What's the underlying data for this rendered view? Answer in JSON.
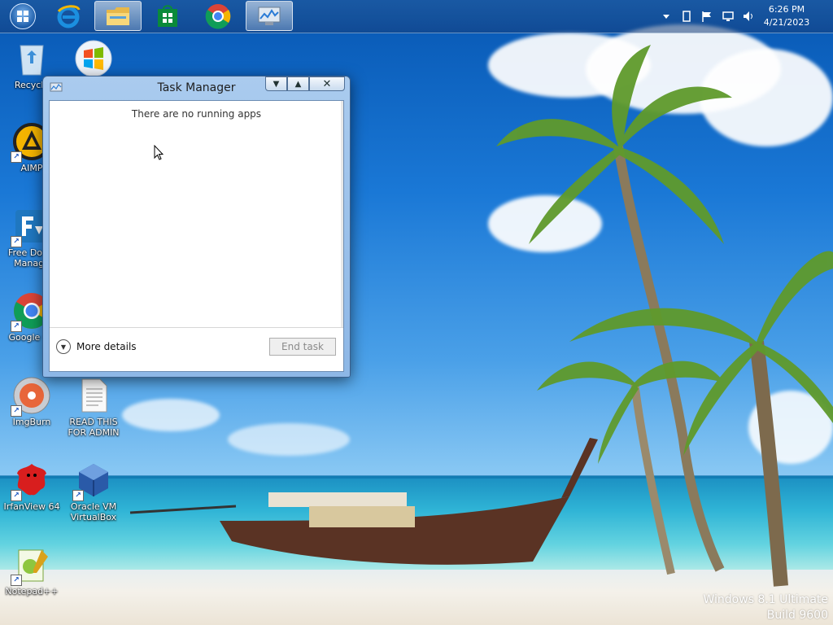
{
  "taskbar": {
    "items": [
      {
        "name": "start",
        "icon": "windows-orb-icon"
      },
      {
        "name": "internet-explorer",
        "icon": "ie-icon"
      },
      {
        "name": "file-explorer",
        "icon": "folder-icon",
        "active": true
      },
      {
        "name": "store",
        "icon": "store-icon"
      },
      {
        "name": "chrome",
        "icon": "chrome-icon"
      },
      {
        "name": "task-manager",
        "icon": "task-manager-icon",
        "active": true
      }
    ],
    "clock": {
      "time": "6:26 PM",
      "date": "4/21/2023"
    }
  },
  "desktop": {
    "icons": [
      {
        "label": "Recycle",
        "icon": "recycle-bin-icon"
      },
      {
        "label": "",
        "icon": "windows-logo-icon"
      },
      {
        "label": "AIMP",
        "icon": "aimp-icon"
      },
      {
        "label": "Free Down Manage",
        "icon": "fdm-icon"
      },
      {
        "label": "Google Ch",
        "icon": "chrome-icon"
      },
      {
        "label": "ImgBurn",
        "icon": "imgburn-icon"
      },
      {
        "label": "READ THIS FOR ADMIN",
        "icon": "text-file-icon"
      },
      {
        "label": "IrfanView 64",
        "icon": "irfanview-icon"
      },
      {
        "label": "Oracle VM VirtualBox",
        "icon": "virtualbox-icon"
      },
      {
        "label": "Notepad++",
        "icon": "notepad-plus-icon"
      }
    ]
  },
  "task_manager": {
    "title": "Task Manager",
    "message": "There are no running apps",
    "more_details": "More details",
    "end_task": "End task"
  },
  "watermark": {
    "line1": "Windows 8.1 Ultimate",
    "line2": "Build 9600"
  },
  "colors": {
    "sky": "#1a78d6",
    "sea": "#2fb4d6",
    "window_frame": "#aacbee"
  }
}
